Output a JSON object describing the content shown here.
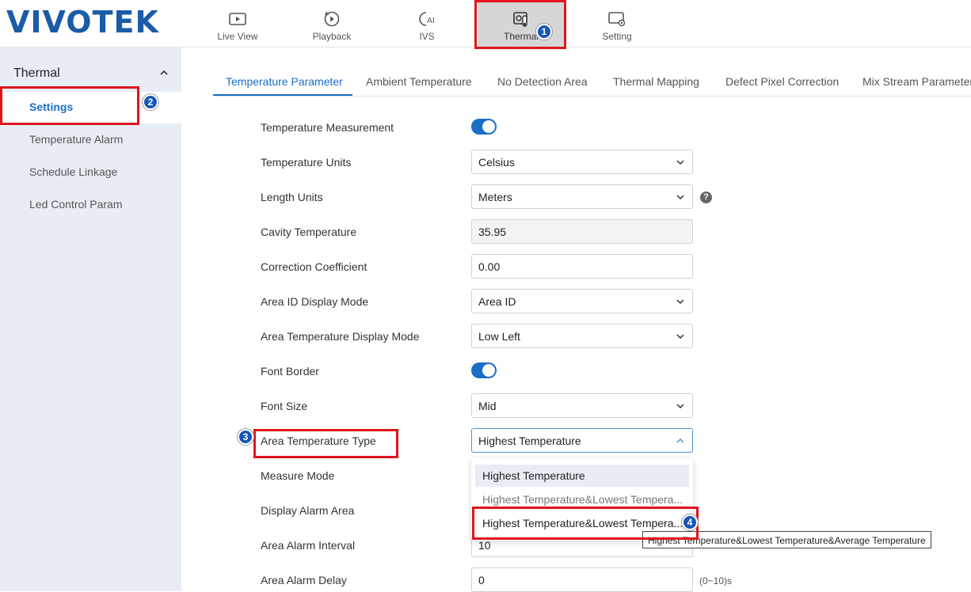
{
  "brand": {
    "logo": "VIVOTEK"
  },
  "nav": [
    {
      "label": "Live View",
      "icon": "live-view-icon"
    },
    {
      "label": "Playback",
      "icon": "playback-icon"
    },
    {
      "label": "IVS",
      "icon": "ai-icon"
    },
    {
      "label": "Thermal",
      "icon": "thermal-icon",
      "active": true
    },
    {
      "label": "Setting",
      "icon": "setting-icon"
    }
  ],
  "sidebar": {
    "section": "Thermal",
    "items": [
      {
        "label": "Settings",
        "active": true
      },
      {
        "label": "Temperature Alarm"
      },
      {
        "label": "Schedule Linkage"
      },
      {
        "label": "Led Control Param"
      }
    ]
  },
  "tabs": [
    {
      "label": "Temperature Parameter",
      "active": true
    },
    {
      "label": "Ambient Temperature"
    },
    {
      "label": "No Detection Area"
    },
    {
      "label": "Thermal Mapping"
    },
    {
      "label": "Defect Pixel Correction"
    },
    {
      "label": "Mix Stream Parameters"
    }
  ],
  "form": {
    "temperature_measurement": {
      "label": "Temperature Measurement",
      "on": true
    },
    "temperature_units": {
      "label": "Temperature Units",
      "value": "Celsius"
    },
    "length_units": {
      "label": "Length Units",
      "value": "Meters",
      "help": "?"
    },
    "cavity_temperature": {
      "label": "Cavity Temperature",
      "value": "35.95"
    },
    "correction_coefficient": {
      "label": "Correction Coefficient",
      "value": "0.00"
    },
    "area_id_display_mode": {
      "label": "Area ID Display Mode",
      "value": "Area ID"
    },
    "area_temp_display_mode": {
      "label": "Area Temperature Display Mode",
      "value": "Low Left"
    },
    "font_border": {
      "label": "Font Border",
      "on": true
    },
    "font_size": {
      "label": "Font Size",
      "value": "Mid"
    },
    "area_temperature_type": {
      "label": "Area Temperature Type",
      "value": "Highest Temperature",
      "options": [
        "Highest Temperature",
        "Highest Temperature&Lowest Tempera...",
        "Highest Temperature&Lowest Tempera..."
      ]
    },
    "measure_mode": {
      "label": "Measure Mode"
    },
    "display_alarm_area": {
      "label": "Display Alarm Area"
    },
    "area_alarm_interval": {
      "label": "Area Alarm Interval",
      "value": "10"
    },
    "area_alarm_delay": {
      "label": "Area Alarm Delay",
      "value": "0",
      "hint": "(0~10)s"
    }
  },
  "tooltip": "Highest Temperature&Lowest Temperature&Average Temperature",
  "badges": [
    "1",
    "2",
    "3",
    "4"
  ],
  "colors": {
    "accent": "#1a6ec8",
    "brand": "#1a5ca8",
    "highlight": "#e0141e",
    "badge": "#1756b8"
  }
}
